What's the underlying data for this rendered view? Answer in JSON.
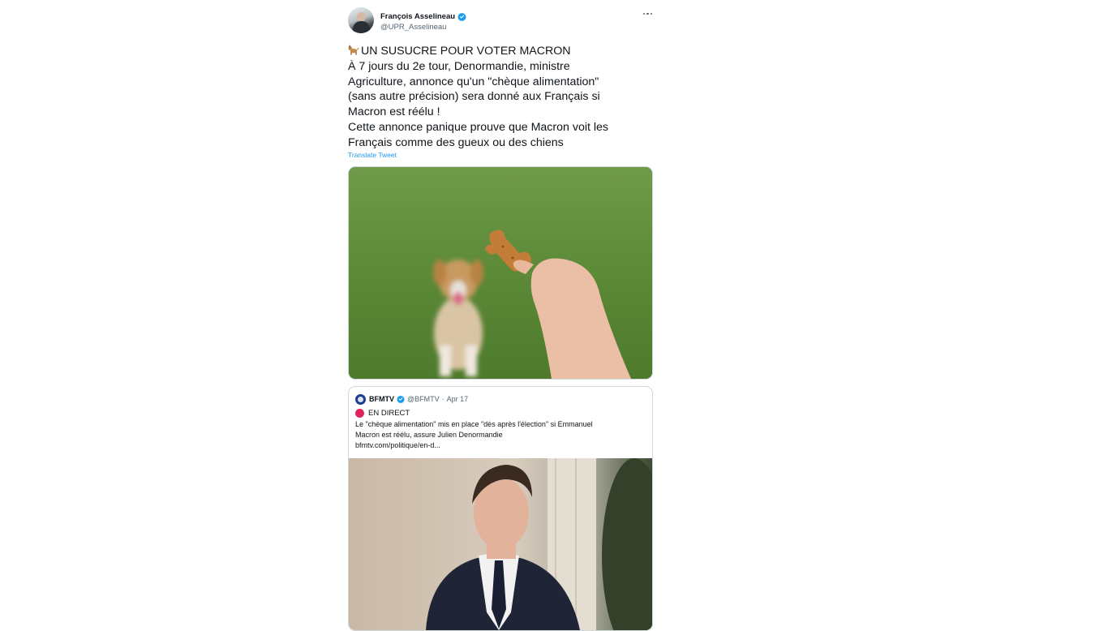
{
  "author": {
    "name": "François Asselineau",
    "handle": "@UPR_Asselineau",
    "avatar_icon": "profile-photo",
    "verified_icon": "verified-badge-icon",
    "verified_color": "#1d9bf0"
  },
  "tweet": {
    "lines": [
      "UN SUSUCRE POUR VOTER MACRON",
      "À 7 jours du 2e tour, Denormandie, ministre",
      "Agriculture, annonce qu'un \"chèque alimentation\"",
      "(sans autre précision) sera donné aux Français si",
      "Macron est réélu !",
      "Cette annonce panique prouve que Macron voit les",
      "Français comme des gueux ou des chiens"
    ],
    "leading_emoji": "dog-emoji",
    "translate_label": "Translate Tweet",
    "more_icon": "more-options-icon",
    "media_description_icon": "dog-biscuit-photo"
  },
  "quoted": {
    "name": "BFMTV",
    "handle": "@BFMTV",
    "separator": "·",
    "date": "Apr 17",
    "live_label": "EN DIRECT",
    "live_color": "#e0245e",
    "text_lines": [
      "Le \"chèque alimentation\" mis en place \"dès après l'élection\" si Emmanuel",
      "Macron est réélu, assure Julien Denormandie",
      "bfmtv.com/politique/en-d..."
    ],
    "media_icon": "politician-photo"
  },
  "colors": {
    "link": "#1d9bf0",
    "secondary_text": "#536471",
    "border": "#cfd9de"
  }
}
